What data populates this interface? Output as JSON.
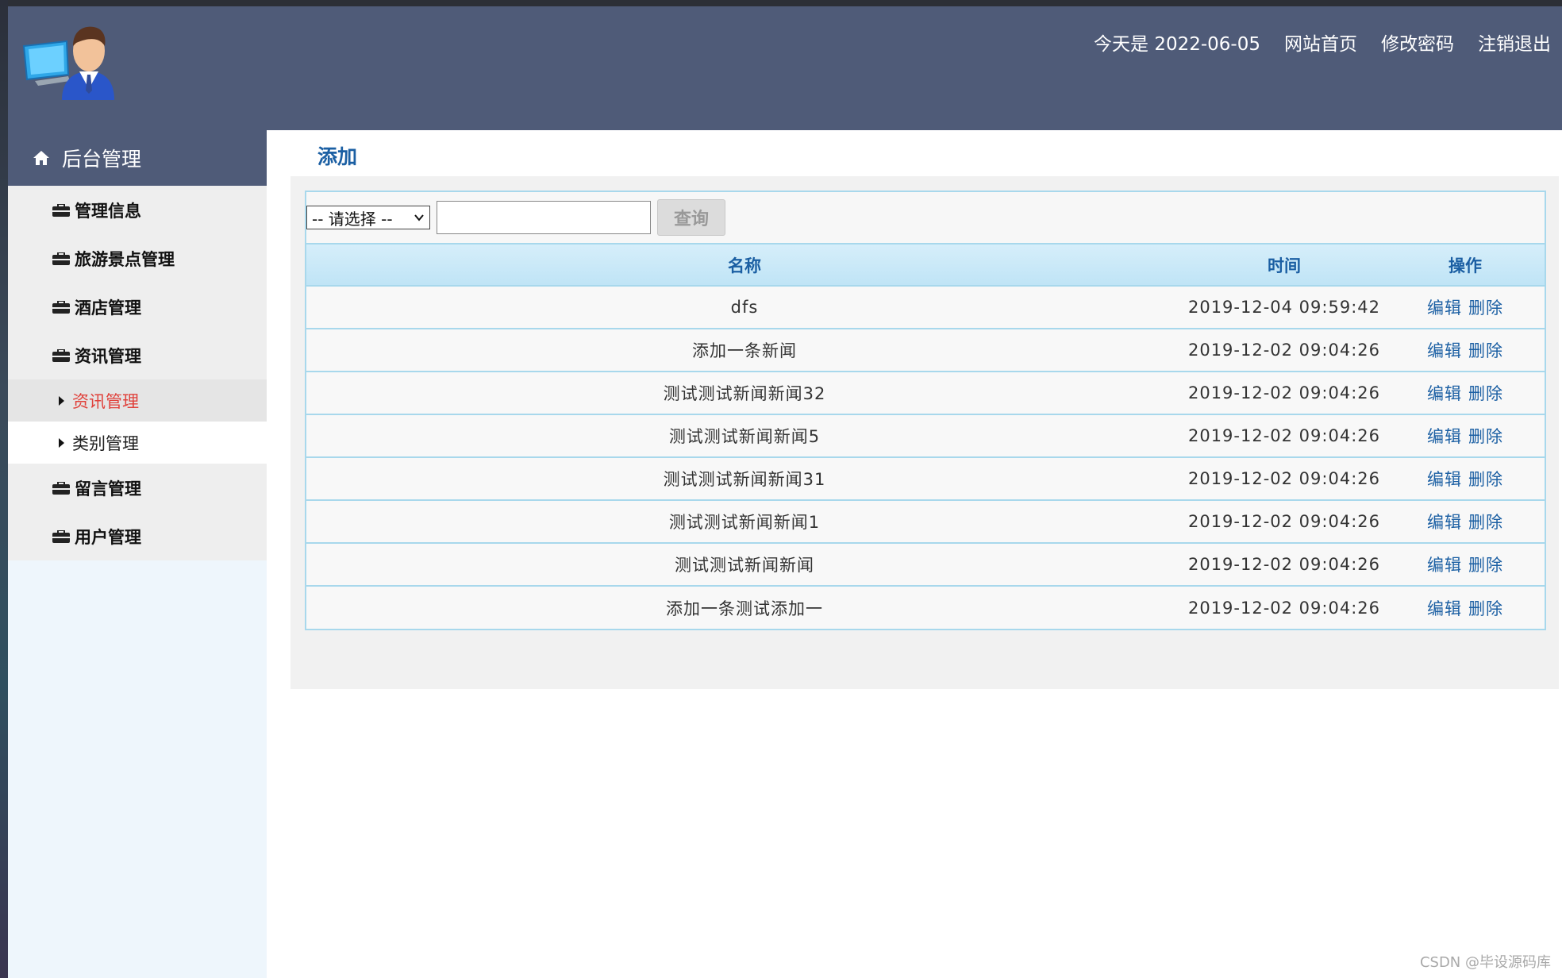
{
  "header": {
    "date_text": "今天是 2022-06-05",
    "links": [
      "网站首页",
      "修改密码",
      "注销退出"
    ]
  },
  "sidebar": {
    "title": "后台管理",
    "items": [
      {
        "label": "管理信息"
      },
      {
        "label": "旅游景点管理"
      },
      {
        "label": "酒店管理"
      },
      {
        "label": "资讯管理"
      }
    ],
    "sub_items": [
      {
        "label": "资讯管理",
        "active": true
      },
      {
        "label": "类别管理",
        "active": false
      }
    ],
    "items_after": [
      {
        "label": "留言管理"
      },
      {
        "label": "用户管理"
      }
    ]
  },
  "main": {
    "title": "添加",
    "search": {
      "select_value": "-- 请选择 --",
      "input_value": "",
      "query_label": "查询"
    },
    "table": {
      "headers": [
        "名称",
        "时间",
        "操作"
      ],
      "rows": [
        {
          "name": "dfs",
          "time": "2019-12-04 09:59:42"
        },
        {
          "name": "添加一条新闻",
          "time": "2019-12-02 09:04:26"
        },
        {
          "name": "测试测试新闻新闻32",
          "time": "2019-12-02 09:04:26"
        },
        {
          "name": "测试测试新闻新闻5",
          "time": "2019-12-02 09:04:26"
        },
        {
          "name": "测试测试新闻新闻31",
          "time": "2019-12-02 09:04:26"
        },
        {
          "name": "测试测试新闻新闻1",
          "time": "2019-12-02 09:04:26"
        },
        {
          "name": "测试测试新闻新闻",
          "time": "2019-12-02 09:04:26"
        },
        {
          "name": "添加一条测试添加一",
          "time": "2019-12-02 09:04:26"
        }
      ],
      "edit_label": "编辑",
      "delete_label": "删除"
    }
  },
  "watermark": "CSDN @毕设源码库",
  "colors": {
    "header_bg": "#4f5b78",
    "accent_blue": "#1b5fa3",
    "active_red": "#e0413b",
    "table_border": "#a8d8ec"
  }
}
